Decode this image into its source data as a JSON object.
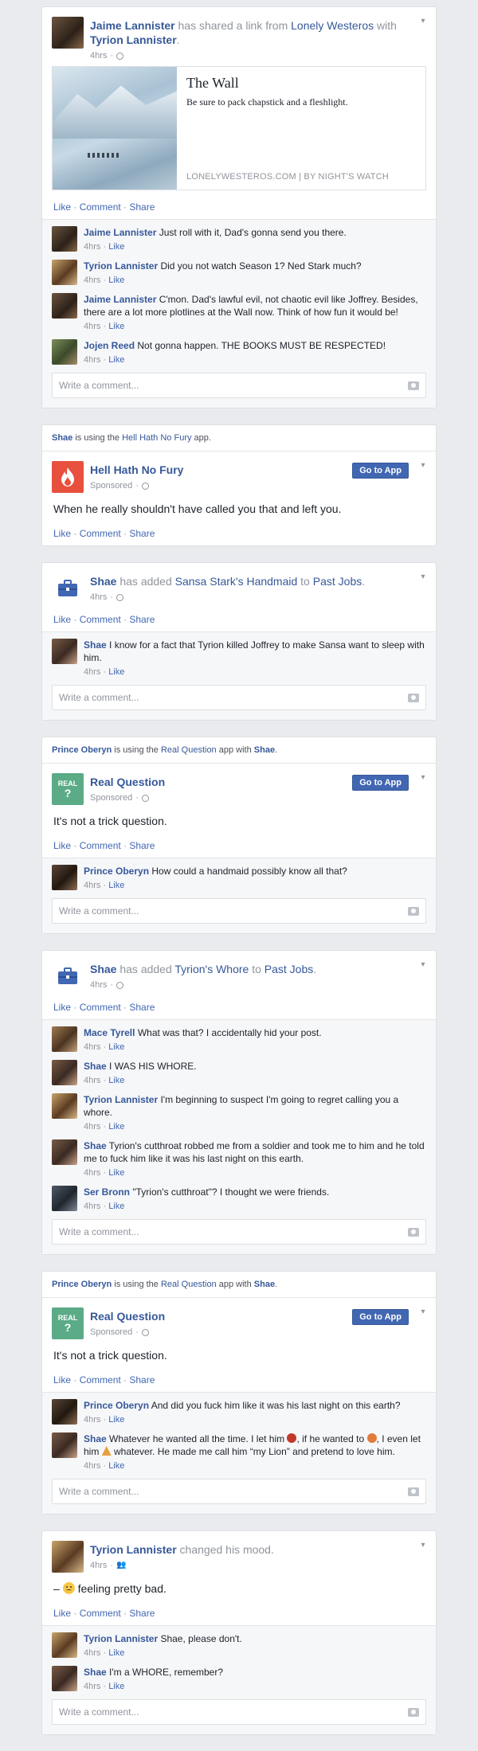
{
  "colors": {
    "link": "#365899",
    "accent": "#4267b2",
    "muted": "#90949c",
    "bg": "#e9ebee",
    "app_red": "#e8503e",
    "app_green": "#5bab87"
  },
  "post1": {
    "actor": "Jaime Lannister",
    "verb": " has shared a link from ",
    "page": "Lonely Westeros",
    "with": " with ",
    "target": "Tyrion Lannister",
    "period": ".",
    "time": "4hrs",
    "link": {
      "title": "The Wall",
      "desc": "Be sure to pack chapstick and a fleshlight.",
      "caption": "LONELYWESTEROS.COM  |  BY NIGHT'S WATCH"
    },
    "actions": {
      "like": "Like",
      "comment": "Comment",
      "share": "Share"
    },
    "comments": [
      {
        "name": "Jaime Lannister",
        "text": " Just roll with it, Dad's gonna send you there.",
        "time": "4hrs",
        "like": "Like"
      },
      {
        "name": "Tyrion Lannister",
        "text": " Did you not watch Season 1? Ned Stark much?",
        "time": "4hrs",
        "like": "Like"
      },
      {
        "name": "Jaime Lannister",
        "text": " C'mon. Dad's lawful evil, not chaotic evil like Joffrey. Besides, there are a lot more plotlines at the Wall now. Think of how fun it would be!",
        "time": "4hrs",
        "like": "Like"
      },
      {
        "name": "Jojen Reed",
        "text": " Not gonna happen. THE BOOKS MUST BE RESPECTED!",
        "time": "4hrs",
        "like": "Like"
      }
    ],
    "write": "Write a comment..."
  },
  "post2": {
    "bar_actor": "Shae",
    "bar_verb": " is using the ",
    "bar_app": "Hell Hath No Fury",
    "bar_end": " app.",
    "app_name": "Hell Hath No Fury",
    "sponsored": "Sponsored",
    "goto": "Go to App",
    "message": "When he really shouldn't have called you that and left you.",
    "actions": {
      "like": "Like",
      "comment": "Comment",
      "share": "Share"
    }
  },
  "post3": {
    "actor": "Shae",
    "verb": " has added ",
    "item": "Sansa Stark's Handmaid",
    "to": " to ",
    "list": "Past Jobs",
    "period": ".",
    "time": "4hrs",
    "actions": {
      "like": "Like",
      "comment": "Comment",
      "share": "Share"
    },
    "comments": [
      {
        "name": "Shae",
        "text": " I know for a fact that Tyrion killed Joffrey to make Sansa want to sleep with him.",
        "time": "4hrs",
        "like": "Like"
      }
    ],
    "write": "Write a comment..."
  },
  "post4": {
    "bar_actor": "Prince Oberyn",
    "bar_verb": " is using the ",
    "bar_app": "Real Question",
    "bar_with": " app with ",
    "bar_target": "Shae",
    "bar_end": ".",
    "app_name": "Real Question",
    "app_icon_text": "REAL",
    "sponsored": "Sponsored",
    "goto": "Go to App",
    "message": "It's not a trick question.",
    "actions": {
      "like": "Like",
      "comment": "Comment",
      "share": "Share"
    },
    "comments": [
      {
        "name": "Prince Oberyn",
        "text": " How could a handmaid possibly know all that?",
        "time": "4hrs",
        "like": "Like"
      }
    ],
    "write": "Write a comment..."
  },
  "post5": {
    "actor": "Shae",
    "verb": " has added ",
    "item": "Tyrion's Whore",
    "to": " to ",
    "list": "Past Jobs",
    "period": ".",
    "time": "4hrs",
    "actions": {
      "like": "Like",
      "comment": "Comment",
      "share": "Share"
    },
    "comments": [
      {
        "name": "Mace Tyrell",
        "text": " What was that? I accidentally hid your post.",
        "time": "4hrs",
        "like": "Like"
      },
      {
        "name": "Shae",
        "text": " I WAS HIS WHORE.",
        "time": "4hrs",
        "like": "Like"
      },
      {
        "name": "Tyrion Lannister",
        "text": " I'm beginning to suspect I'm going to regret calling you a whore.",
        "time": "4hrs",
        "like": "Like"
      },
      {
        "name": "Shae",
        "text": " Tyrion's cutthroat robbed me from a soldier and took me to him and he told me to fuck him like it was his last night on this earth.",
        "time": "4hrs",
        "like": "Like"
      },
      {
        "name": "Ser Bronn",
        "text": " \"Tyrion's cutthroat\"? I thought we were friends.",
        "time": "4hrs",
        "like": "Like"
      }
    ],
    "write": "Write a comment..."
  },
  "post6": {
    "bar_actor": "Prince Oberyn",
    "bar_verb": " is using the ",
    "bar_app": "Real Question",
    "bar_with": " app with ",
    "bar_target": "Shae",
    "bar_end": ".",
    "app_name": "Real Question",
    "app_icon_text": "REAL",
    "sponsored": "Sponsored",
    "goto": "Go to App",
    "message": "It's not a trick question.",
    "actions": {
      "like": "Like",
      "comment": "Comment",
      "share": "Share"
    },
    "comments": [
      {
        "name": "Prince Oberyn",
        "text": " And did you fuck him like it was his last night on this earth?",
        "time": "4hrs",
        "like": "Like"
      }
    ],
    "shae_name": "Shae",
    "shae_t1": " Whatever he wanted all the time. I let him ",
    "shae_t2": ", if he wanted to ",
    "shae_t3": ", I even let him ",
    "shae_t4": " whatever. He made me call him “my Lion” and pretend to love him.",
    "shae_time": "4hrs",
    "shae_like": "Like",
    "write": "Write a comment..."
  },
  "post7": {
    "actor": "Tyrion Lannister",
    "verb": " changed his mood.",
    "time": "4hrs",
    "mood_dash": "–",
    "mood_text": " feeling pretty bad.",
    "actions": {
      "like": "Like",
      "comment": "Comment",
      "share": "Share"
    },
    "comments": [
      {
        "name": "Tyrion Lannister",
        "text": " Shae, please don't.",
        "time": "4hrs",
        "like": "Like"
      },
      {
        "name": "Shae",
        "text": " I'm a WHORE, remember?",
        "time": "4hrs",
        "like": "Like"
      }
    ],
    "write": "Write a comment..."
  }
}
